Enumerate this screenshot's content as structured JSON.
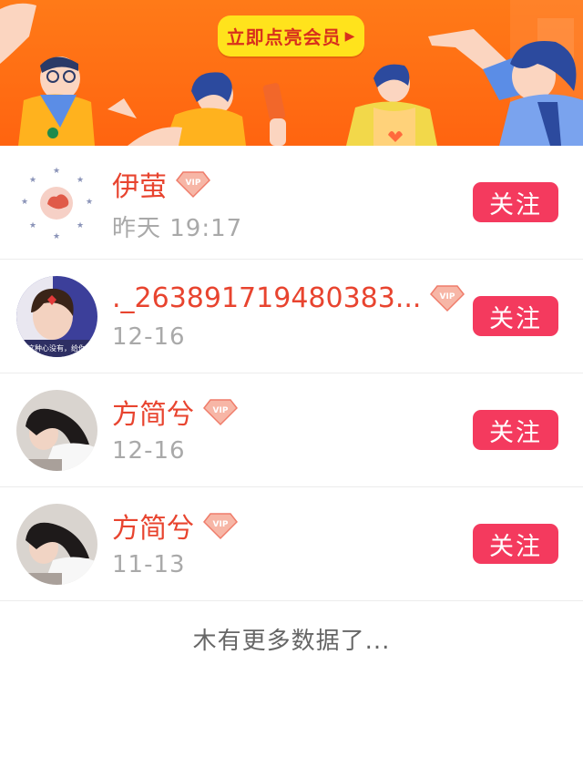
{
  "banner": {
    "cta_label": "立即点亮会员",
    "colors": {
      "background": "#ff6a14",
      "cta": "#ffe31c",
      "cta_text": "#d8301c"
    }
  },
  "list": {
    "items": [
      {
        "name": "伊萤",
        "time": "昨天 19:17",
        "follow_label": "关注",
        "badge": "VIP",
        "avatar": "dotted-circle-avatar"
      },
      {
        "name": "._263891719480383...",
        "time": "12-16",
        "follow_label": "关注",
        "badge": "VIP",
        "avatar": "child-photo-avatar",
        "avatar_caption": "这种心没有，给你"
      },
      {
        "name": "方简兮",
        "time": "12-16",
        "follow_label": "关注",
        "badge": "VIP",
        "avatar": "girl-photo-avatar"
      },
      {
        "name": "方简兮",
        "time": "11-13",
        "follow_label": "关注",
        "badge": "VIP",
        "avatar": "girl-photo-avatar"
      }
    ]
  },
  "footer": {
    "text": "木有更多数据了..."
  },
  "colors": {
    "name": "#e8442f",
    "time": "#a9a9a9",
    "follow_button": "#f43a5e"
  }
}
